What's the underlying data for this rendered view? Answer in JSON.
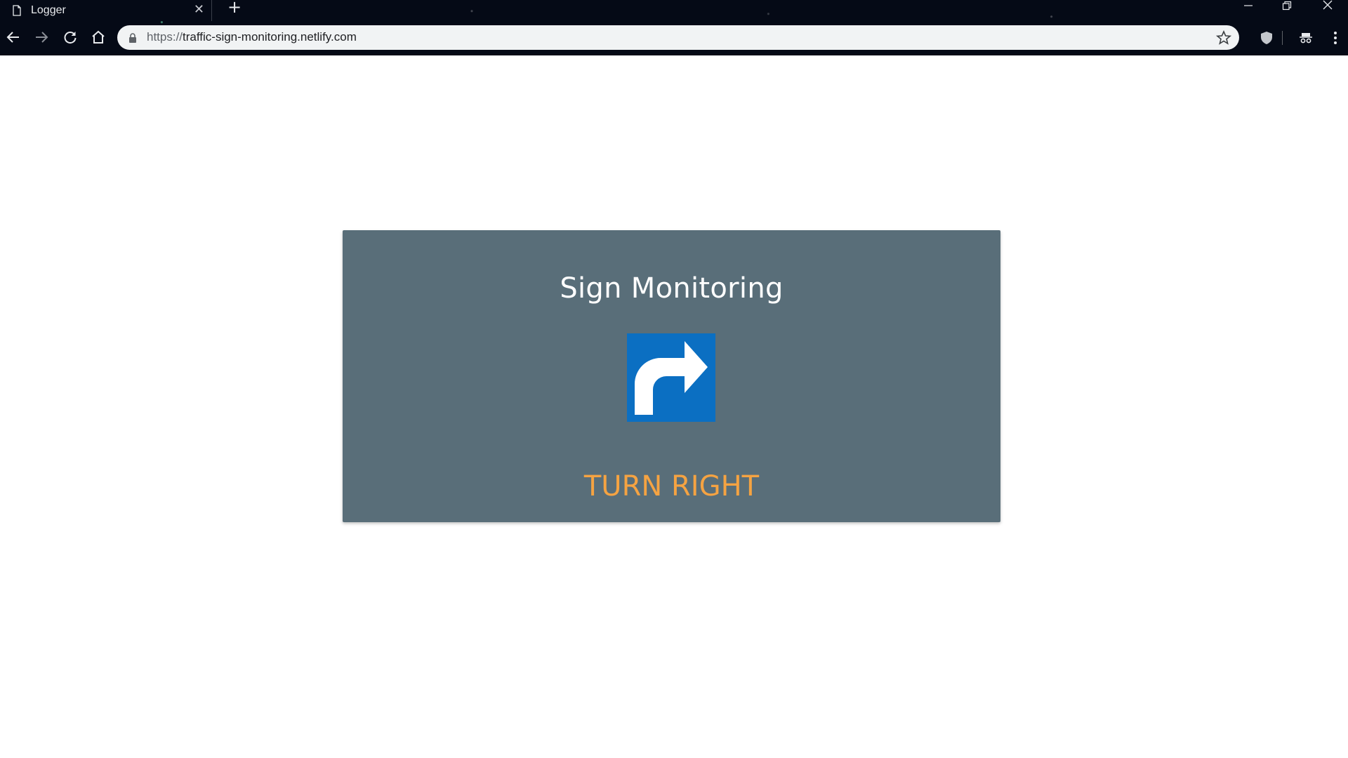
{
  "browser": {
    "tab_title": "Logger",
    "url_protocol": "https://",
    "url_host": "traffic-sign-monitoring.netlify.com"
  },
  "page": {
    "title": "Sign Monitoring",
    "sign_icon": "turn-right-arrow-icon",
    "status": "TURN RIGHT",
    "colors": {
      "card_bg": "#596e79",
      "sign_bg": "#0b6fc2",
      "status_text": "#f5a342",
      "title_text": "#ffffff"
    }
  }
}
